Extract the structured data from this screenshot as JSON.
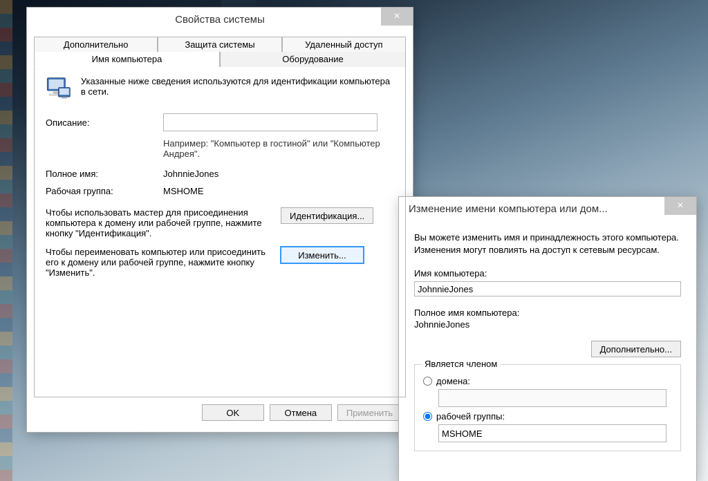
{
  "sysprops": {
    "title": "Свойства системы",
    "tabs": {
      "advanced": "Дополнительно",
      "protection": "Защита системы",
      "remote": "Удаленный доступ",
      "computer_name": "Имя компьютера",
      "hardware": "Оборудование"
    },
    "intro": "Указанные ниже сведения используются для идентификации компьютера в сети.",
    "labels": {
      "description": "Описание:",
      "fullname": "Полное имя:",
      "workgroup": "Рабочая группа:"
    },
    "values": {
      "description": "",
      "fullname": "JohnnieJones",
      "workgroup": "MSHOME"
    },
    "hints": {
      "description": "Например: \"Компьютер в гостиной\" или \"Компьютер Андрея\"."
    },
    "actions": {
      "network_id_text": "Чтобы использовать мастер для присоединения компьютера к домену или рабочей группе, нажмите кнопку \"Идентификация\".",
      "network_id_btn": "Идентификация...",
      "change_text": "Чтобы переименовать компьютер или присоединить его к домену или рабочей группе, нажмите кнопку \"Изменить\".",
      "change_btn": "Изменить..."
    },
    "buttons": {
      "ok": "OK",
      "cancel": "Отмена",
      "apply": "Применить"
    }
  },
  "change": {
    "title": "Изменение имени компьютера или дом...",
    "intro": "Вы можете изменить имя и принадлежность этого компьютера. Изменения могут повлиять на доступ к сетевым ресурсам.",
    "labels": {
      "computer_name": "Имя компьютера:",
      "full_computer_name": "Полное имя компьютера:"
    },
    "values": {
      "computer_name": "JohnnieJones",
      "full_computer_name": "JohnnieJones",
      "domain": "",
      "workgroup": "MSHOME"
    },
    "buttons": {
      "more": "Дополнительно..."
    },
    "group": {
      "legend": "Является членом",
      "domain_label": "домена:",
      "workgroup_label": "рабочей группы:"
    }
  }
}
